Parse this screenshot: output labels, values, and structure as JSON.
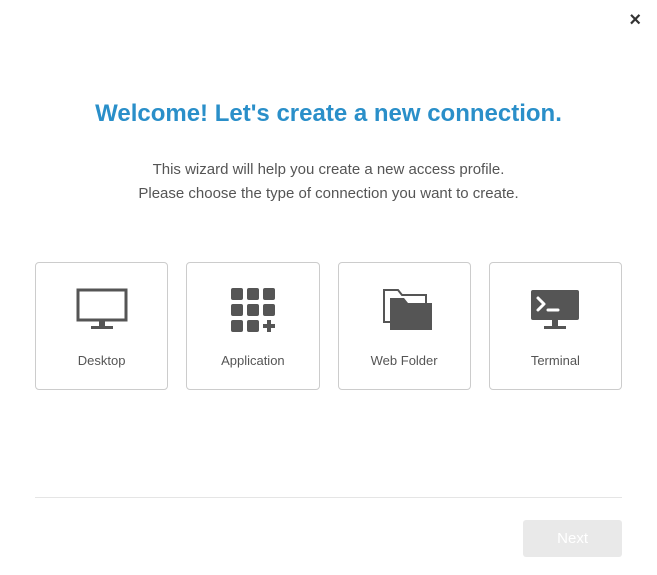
{
  "close_label": "×",
  "title": "Welcome! Let's create a new connection.",
  "subtitle_line1": "This wizard will help you create a new access profile.",
  "subtitle_line2": "Please choose the type of connection you want to create.",
  "options": {
    "desktop": {
      "label": "Desktop"
    },
    "application": {
      "label": "Application"
    },
    "webfolder": {
      "label": "Web Folder"
    },
    "terminal": {
      "label": "Terminal"
    }
  },
  "buttons": {
    "next": "Next"
  }
}
